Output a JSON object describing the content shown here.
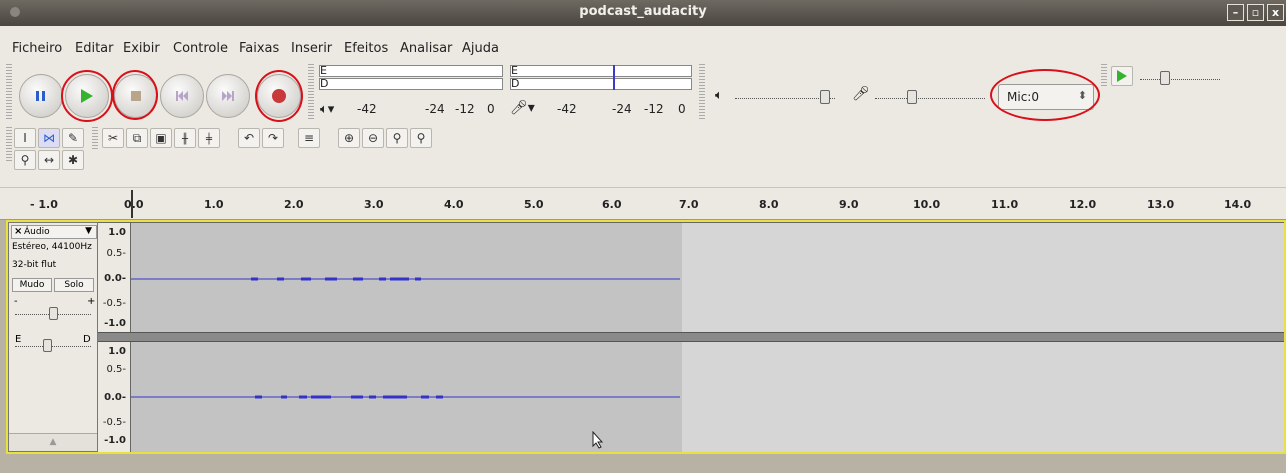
{
  "window": {
    "title": "podcast_audacity"
  },
  "menu": [
    "Ficheiro",
    "Editar",
    "Exibir",
    "Controle",
    "Faixas",
    "Inserir",
    "Efeitos",
    "Analisar",
    "Ajuda"
  ],
  "meters": {
    "out_channel_top": "E",
    "out_channel_bottom": "D",
    "in_channel_top": "E",
    "in_channel_bottom": "D",
    "scale": [
      "-42",
      "-24",
      "-12",
      "0"
    ]
  },
  "device": {
    "input": "Mic:0"
  },
  "ruler": [
    "- 1.0",
    "0.0",
    "1.0",
    "2.0",
    "3.0",
    "4.0",
    "5.0",
    "6.0",
    "7.0",
    "8.0",
    "9.0",
    "10.0",
    "11.0",
    "12.0",
    "13.0",
    "14.0"
  ],
  "track": {
    "name": "Áudio",
    "info1": "Estéreo, 44100Hz",
    "info2": "32-bit flut",
    "mute": "Mudo",
    "solo": "Solo",
    "gain_minus": "-",
    "gain_plus": "+",
    "pan_left": "E",
    "pan_right": "D",
    "scale": [
      "1.0",
      "0.5-",
      "0.0-",
      "-0.5-",
      "-1.0"
    ],
    "audio_end_seconds": 7.0
  },
  "colors": {
    "record_ring": "#d8101a",
    "play": "#35b32e",
    "wave": "#3333cc"
  }
}
